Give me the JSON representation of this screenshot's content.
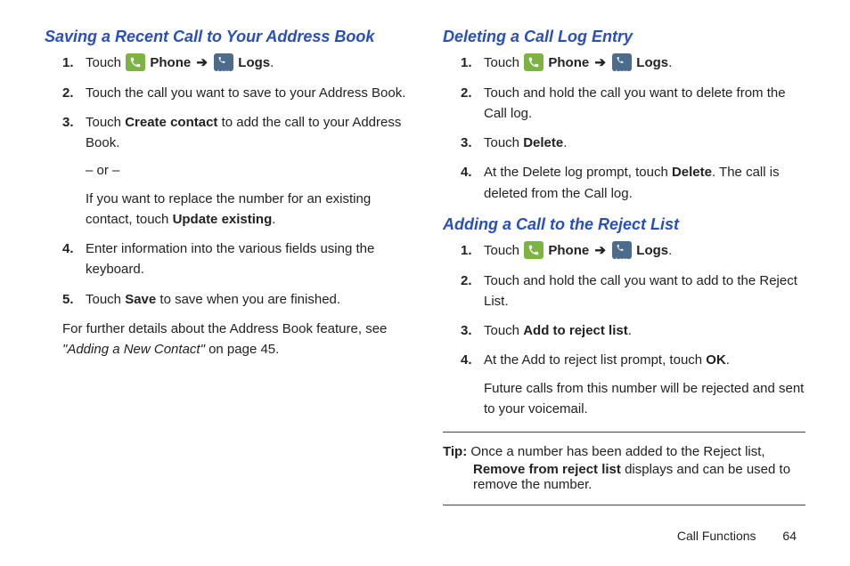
{
  "left": {
    "heading": "Saving a Recent Call to Your Address Book",
    "s1_a": "Touch ",
    "s1_phone": " Phone ",
    "s1_arrow": "➔",
    "s1_logs": " Logs",
    "s1_end": ".",
    "s2": "Touch the call you want to save to your Address Book.",
    "s3_a": "Touch ",
    "s3_b": "Create contact",
    "s3_c": " to add the call to your Address Book.",
    "s3_or": "– or –",
    "s3_d": "If you want to replace the number for an existing contact, touch ",
    "s3_e": "Update existing",
    "s3_f": ".",
    "s4": "Enter information into the various fields using the keyboard.",
    "s5_a": "Touch ",
    "s5_b": "Save",
    "s5_c": " to save when you are finished.",
    "note_a": "For further details about the Address Book feature, see ",
    "note_b": "\"Adding a New Contact\"",
    "note_c": " on page 45."
  },
  "right": {
    "h1": "Deleting a Call Log Entry",
    "d1_a": "Touch ",
    "d1_phone": " Phone ",
    "d1_arrow": "➔",
    "d1_logs": " Logs",
    "d1_end": ".",
    "d2": "Touch and hold the call you want to delete from the Call log.",
    "d3_a": "Touch ",
    "d3_b": "Delete",
    "d3_c": ".",
    "d4_a": "At the Delete log prompt, touch ",
    "d4_b": "Delete",
    "d4_c": ". The call is deleted from the Call log.",
    "h2": "Adding a Call to the Reject List",
    "r1_a": "Touch ",
    "r1_phone": " Phone ",
    "r1_arrow": "➔",
    "r1_logs": " Logs",
    "r1_end": ".",
    "r2": "Touch and hold the call you want to add to the Reject List.",
    "r3_a": "Touch ",
    "r3_b": "Add to reject list",
    "r3_c": ".",
    "r4_a": "At the Add to reject list prompt, touch ",
    "r4_b": "OK",
    "r4_c": ".",
    "r4_sub": "Future calls from this number will be rejected and sent to your voicemail.",
    "tip_label": "Tip:",
    "tip_a": " Once a number has been added to the Reject list, ",
    "tip_b": "Remove from reject list",
    "tip_c": " displays and can be used to remove the number."
  },
  "footer": {
    "section": "Call Functions",
    "page": "64"
  },
  "icons": {
    "logs_label": "Logs"
  }
}
